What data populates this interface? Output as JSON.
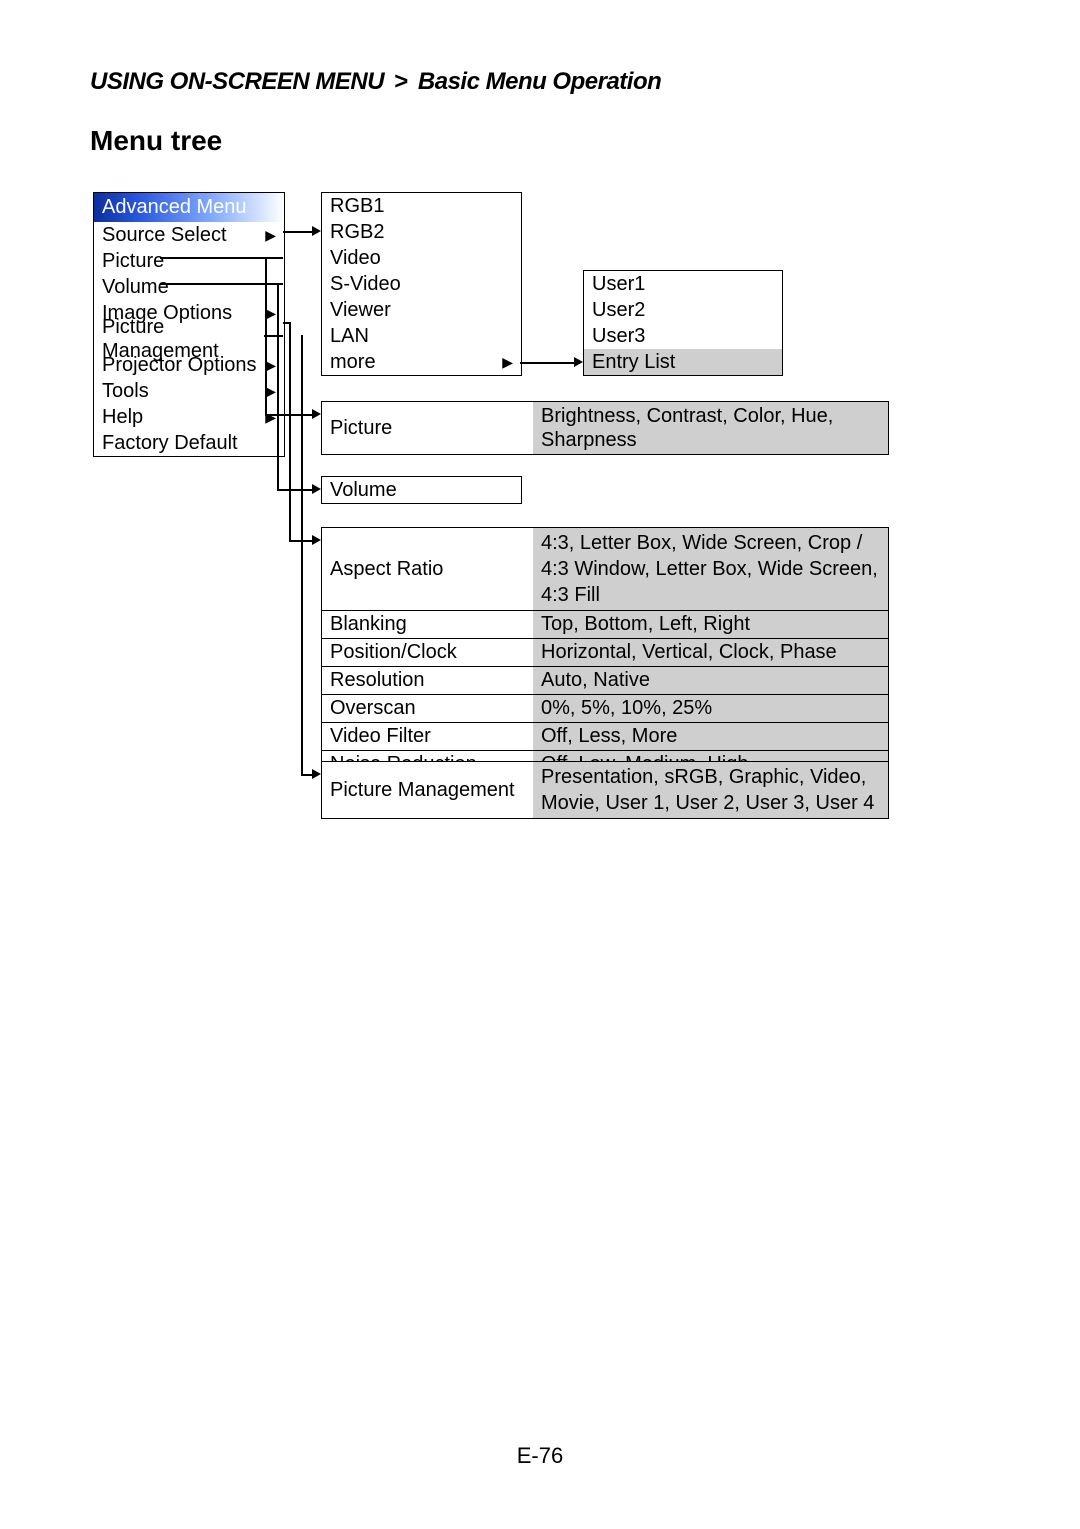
{
  "breadcrumb": {
    "section": "USING ON-SCREEN MENU",
    "sep": ">",
    "page": "Basic Menu Operation"
  },
  "title": "Menu tree",
  "page_number": "E-76",
  "main_menu": {
    "header": "Advanced Menu",
    "items": [
      {
        "label": "Source Select",
        "arrow": true
      },
      {
        "label": "Picture",
        "arrow": false
      },
      {
        "label": "Volume",
        "arrow": false
      },
      {
        "label": "Image Options",
        "arrow": true
      },
      {
        "label": "Picture Management",
        "arrow": false
      },
      {
        "label": "Projector Options",
        "arrow": true
      },
      {
        "label": "Tools",
        "arrow": true
      },
      {
        "label": "Help",
        "arrow": true
      },
      {
        "label": "Factory Default",
        "arrow": false
      }
    ]
  },
  "source_list": {
    "items": [
      "RGB1",
      "RGB2",
      "Video",
      "S-Video",
      "Viewer",
      "LAN",
      "more"
    ]
  },
  "user_list": {
    "items": [
      "User1",
      "User2",
      "User3",
      "Entry List"
    ]
  },
  "picture_box": {
    "label": "Picture",
    "values": "Brightness, Contrast, Color, Hue, Sharpness"
  },
  "volume_box": {
    "label": "Volume"
  },
  "image_options": [
    {
      "label": "Aspect Ratio",
      "values": "4:3, Letter Box, Wide Screen, Crop / 4:3 Window, Letter Box, Wide Screen, 4:3 Fill"
    },
    {
      "label": "Blanking",
      "values": "Top, Bottom, Left, Right"
    },
    {
      "label": "Position/Clock",
      "values": "Horizontal, Vertical, Clock, Phase"
    },
    {
      "label": "Resolution",
      "values": "Auto, Native"
    },
    {
      "label": "Overscan",
      "values": "0%, 5%, 10%, 25%"
    },
    {
      "label": "Video Filter",
      "values": "Off, Less, More"
    },
    {
      "label": "Noise Reduction",
      "values": "Off, Low, Medium, High"
    }
  ],
  "picture_mgmt": {
    "label": "Picture Management",
    "values": "Presentation, sRGB, Graphic, Video, Movie, User 1, User 2, User 3, User 4"
  }
}
